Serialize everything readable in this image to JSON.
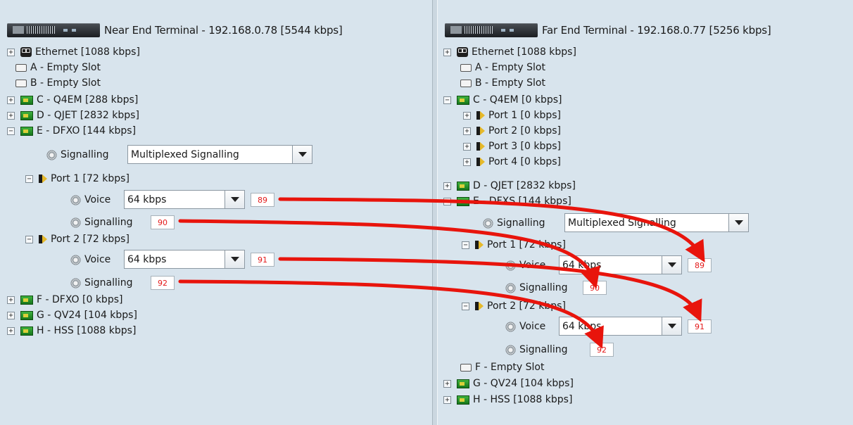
{
  "near": {
    "header": "Near End Terminal - 192.168.0.78 [5544 kbps]",
    "rows": {
      "ethernet": "Ethernet [1088 kbps]",
      "slot_a": "A - Empty Slot",
      "slot_b": "B - Empty Slot",
      "slot_c": "C - Q4EM [288 kbps]",
      "slot_d": "D - QJET [2832 kbps]",
      "slot_e": "E - DFXO [144 kbps]",
      "signalling": "Signalling",
      "signalling_value": "Multiplexed Signalling",
      "port1": "Port 1 [72 kbps]",
      "port1_voice": "Voice",
      "port1_voice_value": "64 kbps",
      "port1_voice_id": "89",
      "port1_signalling": "Signalling",
      "port1_signalling_id": "90",
      "port2": "Port 2 [72 kbps]",
      "port2_voice": "Voice",
      "port2_voice_value": "64 kbps",
      "port2_voice_id": "91",
      "port2_signalling": "Signalling",
      "port2_signalling_id": "92",
      "slot_f": "F - DFXO [0 kbps]",
      "slot_g": "G - QV24 [104 kbps]",
      "slot_h": "H - HSS [1088 kbps]"
    }
  },
  "far": {
    "header": "Far End Terminal - 192.168.0.77 [5256 kbps]",
    "rows": {
      "ethernet": "Ethernet [1088 kbps]",
      "slot_a": "A - Empty Slot",
      "slot_b": "B - Empty Slot",
      "slot_c": "C - Q4EM [0 kbps]",
      "c_port1": "Port 1 [0 kbps]",
      "c_port2": "Port 2 [0 kbps]",
      "c_port3": "Port 3 [0 kbps]",
      "c_port4": "Port 4 [0 kbps]",
      "slot_d": "D - QJET [2832 kbps]",
      "slot_e": "E - DFXS [144 kbps]",
      "signalling": "Signalling",
      "signalling_value": "Multiplexed Signalling",
      "port1": "Port 1 [72 kbps]",
      "port1_voice": "Voice",
      "port1_voice_value": "64 kbps",
      "port1_voice_id": "89",
      "port1_signalling": "Signalling",
      "port1_signalling_id": "90",
      "port2": "Port 2 [72 kbps]",
      "port2_voice": "Voice",
      "port2_voice_value": "64 kbps",
      "port2_voice_id": "91",
      "port2_signalling": "Signalling",
      "port2_signalling_id": "92",
      "slot_f": "F - Empty Slot",
      "slot_g": "G - QV24 [104 kbps]",
      "slot_h": "H - HSS [1088 kbps]"
    }
  },
  "colors": {
    "arrow": "#e8140c",
    "badge_text": "#e31919",
    "background": "#d8e4ed"
  },
  "icons": [
    "expand-icon",
    "collapse-icon",
    "ethernet-icon",
    "empty-slot-icon",
    "card-icon",
    "port-icon",
    "gear-icon",
    "dropdown-caret-icon",
    "device-icon"
  ]
}
